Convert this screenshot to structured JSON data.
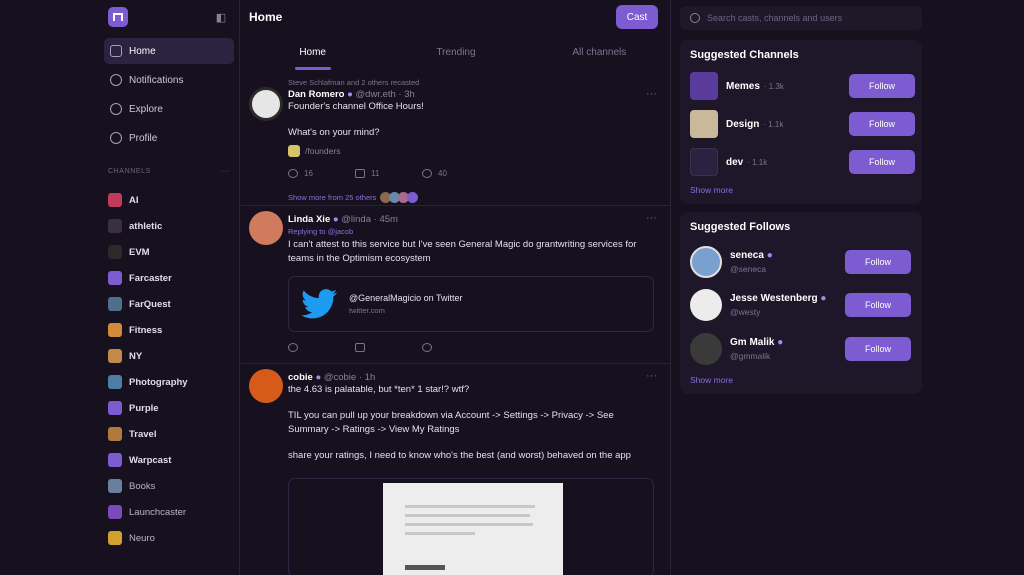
{
  "sidebar": {
    "nav": [
      {
        "label": "Home",
        "icon": "home-icon"
      },
      {
        "label": "Notifications",
        "icon": "bell-icon"
      },
      {
        "label": "Explore",
        "icon": "search-icon"
      },
      {
        "label": "Profile",
        "icon": "user-icon"
      }
    ],
    "channels_heading": "CHANNELS",
    "channels_more": "···",
    "channels": [
      {
        "label": "AI",
        "color": "#c23b5c"
      },
      {
        "label": "athletic",
        "color": "#3a3040"
      },
      {
        "label": "EVM",
        "color": "#2a2a2a"
      },
      {
        "label": "Farcaster",
        "color": "#7c5cd0"
      },
      {
        "label": "FarQuest",
        "color": "#4f6f8c"
      },
      {
        "label": "Fitness",
        "color": "#d18a3a"
      },
      {
        "label": "NY",
        "color": "#c28a4a"
      },
      {
        "label": "Photography",
        "color": "#4e7ea3"
      },
      {
        "label": "Purple",
        "color": "#7c5cd0"
      },
      {
        "label": "Travel",
        "color": "#b07a3e"
      },
      {
        "label": "Warpcast",
        "color": "#7c5cd0"
      },
      {
        "label": "Books",
        "color": "#6a7fa0"
      },
      {
        "label": "Launchcaster",
        "color": "#7a4ab8"
      },
      {
        "label": "Neuro",
        "color": "#d0a030"
      }
    ]
  },
  "feed": {
    "title": "Home",
    "cast_label": "Cast",
    "tabs": [
      "Home",
      "Trending",
      "All channels"
    ],
    "posts": [
      {
        "context": "Steve Schlafman and 2 others recasted",
        "name": "Dan Romero",
        "handle": "@dwr.eth",
        "time": "3h",
        "text": "Founder's channel Office Hours!",
        "text2": "What's on your mind?",
        "channel": "/founders",
        "replies": "16",
        "recasts": "11",
        "likes": "40",
        "thread": "Show more from 25 others"
      },
      {
        "name": "Linda Xie",
        "handle": "@linda",
        "time": "45m",
        "context": "Replying to @jacob",
        "text": "I can't attest to this service but I've seen General Magic do grantwriting services for teams in the Optimism ecosystem",
        "embed_title": "@GeneralMagicio on Twitter",
        "embed_url": "twitter.com"
      },
      {
        "name": "cobie",
        "handle": "@cobie",
        "time": "1h",
        "text": "the 4.63 is palatable, but *ten* 1 star!? wtf?",
        "text2": "TIL you can pull up your breakdown via Account -> Settings -> Privacy -> See Summary -> Ratings -> View My Ratings",
        "text3": "share your ratings, I need to know who's the best (and worst) behaved on the app"
      }
    ]
  },
  "right": {
    "search_placeholder": "Search casts, channels and users",
    "channels_title": "Suggested Channels",
    "channels": [
      {
        "name": "Memes",
        "sub": "· 1.3k",
        "color": "#5a3a9a"
      },
      {
        "name": "Design",
        "sub": "· 1.1k",
        "color": "#c9b89a"
      },
      {
        "name": "dev",
        "sub": "· 1.1k",
        "color": "#2a2240"
      }
    ],
    "follows_title": "Suggested Follows",
    "follows": [
      {
        "name": "seneca",
        "handle": "@seneca"
      },
      {
        "name": "Jesse Westenberg",
        "handle": "@westy"
      },
      {
        "name": "Gm Malik",
        "handle": "@gmmalik"
      }
    ],
    "follow_label": "Follow",
    "show_more": "Show more"
  }
}
